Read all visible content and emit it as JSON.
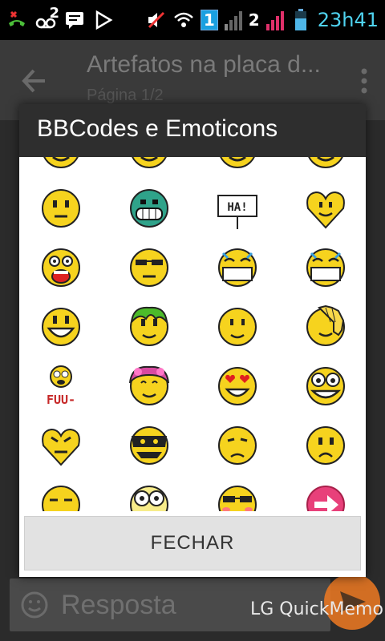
{
  "status_bar": {
    "notification_badge": "2",
    "sim1_label": "1",
    "sim2_label": "2",
    "time": "23h41",
    "icons": [
      "missed-call-icon",
      "voicemail-icon",
      "message-icon",
      "play-store-icon",
      "mute-icon",
      "wifi-icon",
      "signal-icon",
      "battery-icon"
    ]
  },
  "app": {
    "title": "Artefatos na placa d...",
    "subtitle": "Página 1/2",
    "reply_placeholder": "Resposta"
  },
  "dialog": {
    "title": "BBCodes e Emoticons",
    "close_label": "FECHAR",
    "emoticons": [
      [
        "smiley-partial-icon",
        "smiley-partial-icon",
        "smiley-partial-icon",
        "smiley-partial-icon"
      ],
      [
        "neutral-face-icon",
        "grin-teeth-icon",
        "ha-sign-icon",
        "heart-face-icon"
      ],
      [
        "shocked-face-icon",
        "sunglasses-face-icon",
        "mask-face-icon",
        "mask-face-icon"
      ],
      [
        "happy-laugh-icon",
        "green-hair-face-icon",
        "smile-face-icon",
        "facepalm-icon"
      ],
      [
        "fuu-face-icon",
        "flower-girl-face-icon",
        "heart-eyes-icon",
        "big-eyes-grin-icon"
      ],
      [
        "angry-heart-icon",
        "masked-bandit-icon",
        "sad-face-icon",
        "worried-face-icon"
      ],
      [
        "annoyed-face-icon",
        "crazy-eyes-icon",
        "cool-glasses-icon",
        "arrow-right-icon"
      ]
    ],
    "fuu_text": "FUU-",
    "ha_text": "HA!"
  },
  "watermark": "LG QuickMemo",
  "colors": {
    "accent_send": "#f07a22",
    "time_color": "#4fd3f0",
    "face_yellow": "#f6d31e"
  }
}
